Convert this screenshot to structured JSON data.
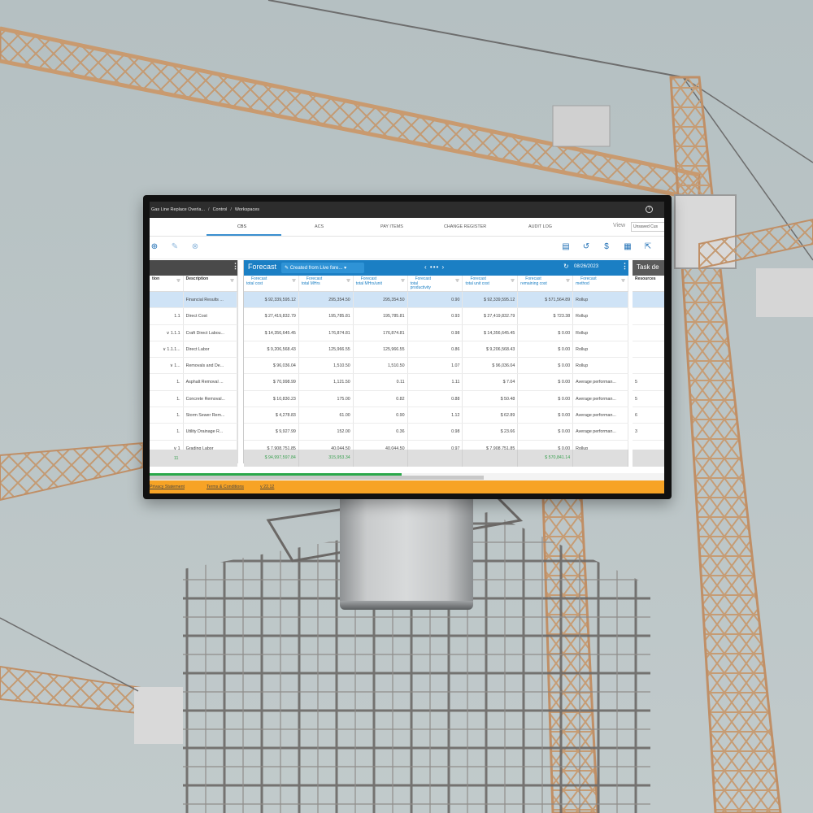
{
  "header": {
    "breadcrumbs": [
      "Gas Line Replace Overla...",
      "Control",
      "Workspaces"
    ],
    "separators": [
      "/",
      "/"
    ],
    "help_icon": "?"
  },
  "tabs": [
    {
      "label": "CBS",
      "active": true
    },
    {
      "label": "ACS",
      "active": false
    },
    {
      "label": "PAY ITEMS",
      "active": false
    },
    {
      "label": "CHANGE REGISTER",
      "active": false
    },
    {
      "label": "AUDIT LOG",
      "active": false
    }
  ],
  "view": {
    "label": "View",
    "selected": "Unsaved Cus"
  },
  "toolbar": {
    "left_icons": [
      "add-circle-icon",
      "edit-icon",
      "remove-circle-icon"
    ],
    "right_icons": [
      "table-view-icon",
      "undo-icon",
      "dollar-icon",
      "calendar-icon",
      "export-icon"
    ]
  },
  "left_panel": {
    "columns": [
      "tion",
      "Description"
    ],
    "rows": [
      {
        "code": "",
        "description": "Financial Results ..."
      },
      {
        "code": "1.1",
        "description": "Direct Cost"
      },
      {
        "code": "∨ 1.1.1",
        "description": "Craft Direct Labou..."
      },
      {
        "code": "∨ 1.1.1...",
        "description": "Direct Labor"
      },
      {
        "code": "∨ 1...",
        "description": "Removals and De..."
      },
      {
        "code": "1.",
        "description": "Asphalt Removal ..."
      },
      {
        "code": "1.",
        "description": "Concrete Removal..."
      },
      {
        "code": "1.",
        "description": "Storm Sewer Rem..."
      },
      {
        "code": "1.",
        "description": "Utility Drainage R..."
      },
      {
        "code": "∨ 1",
        "description": "Grading Labor"
      }
    ],
    "total": "11"
  },
  "forecast_panel": {
    "title": "Forecast",
    "chip": "Created from Live fore...",
    "date": "08/26/2023",
    "columns": [
      "Forecast total cost",
      "Forecast total MHrs",
      "Forecast total MHrs/unit",
      "Forecast total productivity",
      "Forecast total unit cost",
      "Forecast remaining cost",
      "Forecast method"
    ],
    "column_lines": [
      [
        "Forecast",
        "total cost"
      ],
      [
        "Forecast",
        "total MHrs"
      ],
      [
        "Forecast",
        "total MHrs/unit"
      ],
      [
        "Forecast",
        "total",
        "productivity"
      ],
      [
        "Forecast",
        "total unit cost"
      ],
      [
        "Forecast",
        "remaining cost"
      ],
      [
        "Forecast",
        "method"
      ]
    ],
    "rows": [
      [
        "$ 92,339,595.12",
        "295,354.50",
        "295,354.50",
        "0.90",
        "$ 92,339,595.12",
        "$ 571,564.89",
        "Rollup"
      ],
      [
        "$ 27,419,832.79",
        "195,785.81",
        "195,785.81",
        "0.93",
        "$ 27,419,832.79",
        "$ 723.38",
        "Rollup"
      ],
      [
        "$ 14,356,645.45",
        "176,874.81",
        "176,874.81",
        "0.98",
        "$ 14,356,645.45",
        "$ 0.00",
        "Rollup"
      ],
      [
        "$ 9,206,568.43",
        "125,966.55",
        "125,966.55",
        "0.86",
        "$ 9,206,568.43",
        "$ 0.00",
        "Rollup"
      ],
      [
        "$ 96,036.04",
        "1,510.50",
        "1,510.50",
        "1.07",
        "$ 96,036.04",
        "$ 0.00",
        "Rollup"
      ],
      [
        "$ 70,998.99",
        "1,121.50",
        "0.11",
        "1.11",
        "$ 7.04",
        "$ 0.00",
        "Average performan..."
      ],
      [
        "$ 10,830.23",
        "175.00",
        "0.82",
        "0.88",
        "$ 50.48",
        "$ 0.00",
        "Average performan..."
      ],
      [
        "$ 4,278.83",
        "61.00",
        "0.90",
        "1.12",
        "$ 62.89",
        "$ 0.00",
        "Average performan..."
      ],
      [
        "$ 9,927.99",
        "152.00",
        "0.36",
        "0.98",
        "$ 23.66",
        "$ 0.00",
        "Average performan..."
      ],
      [
        "$ 7,908,751.85",
        "40,044.50",
        "40,044.50",
        "0.97",
        "$ 7,908,751.85",
        "$ 0.00",
        "Rollup"
      ]
    ],
    "totals": [
      "$ 94,997,597.84",
      "315,953.34",
      "",
      "",
      "",
      "$ 570,841.14",
      ""
    ]
  },
  "right_panel": {
    "title": "Task de",
    "column": "Resources",
    "values": [
      "",
      "",
      "",
      "",
      "",
      "5",
      "5",
      "6",
      "3",
      ""
    ]
  },
  "footer": {
    "links": [
      "Privacy Statement",
      "Terms & Conditions",
      "v 22.12"
    ]
  },
  "progress": {
    "green_fraction": 0.49
  }
}
